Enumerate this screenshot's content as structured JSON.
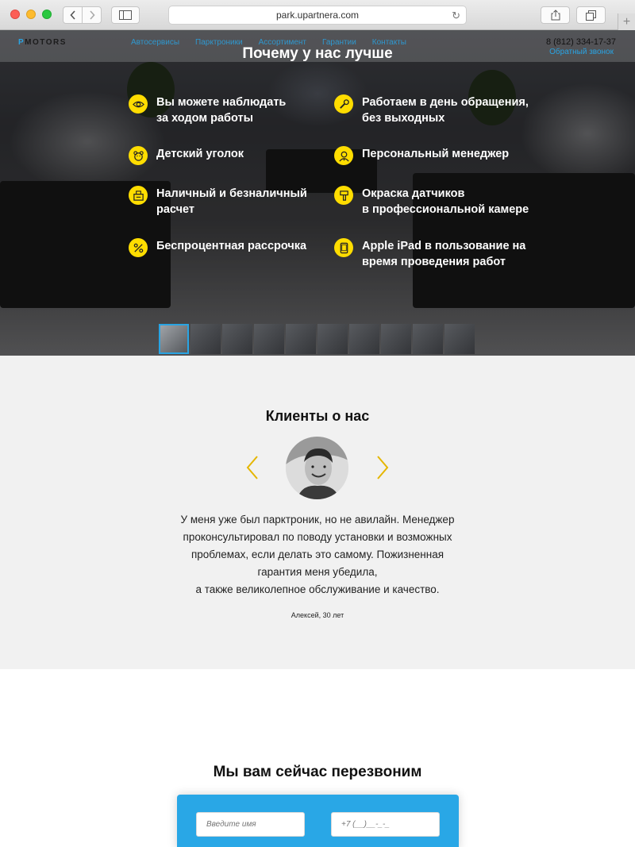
{
  "browser": {
    "url": "park.upartnera.com"
  },
  "site": {
    "logo_prefix": "P",
    "logo_text": "MOTORS",
    "nav": [
      "Автосервисы",
      "Парктроники",
      "Ассортимент",
      "Гарантии",
      "Контакты"
    ],
    "phone": "8 (812) 334-17-37",
    "callback_link": "Обратный звонок",
    "accent_color": "#29a4e3",
    "icon_color": "#ffdd00"
  },
  "hero": {
    "title": "Почему у нас лучше",
    "features": [
      {
        "icon": "eye-icon",
        "line1": "Вы можете наблюдать",
        "line2": "за ходом работы"
      },
      {
        "icon": "wrench-icon",
        "line1": "Работаем в день обращения,",
        "line2": "без выходных"
      },
      {
        "icon": "teddy-bear-icon",
        "line1": "Детский уголок",
        "line2": ""
      },
      {
        "icon": "manager-icon",
        "line1": "Персональный менеджер",
        "line2": ""
      },
      {
        "icon": "cash-register-icon",
        "line1": "Наличный и безналичный",
        "line2": "расчет"
      },
      {
        "icon": "spray-gun-icon",
        "line1": "Окраска датчиков",
        "line2": "в профессиональной камере"
      },
      {
        "icon": "percent-icon",
        "line1": "Беспроцентная рассрочка",
        "line2": ""
      },
      {
        "icon": "tablet-icon",
        "line1": "Apple iPad в пользование на",
        "line2": "время проведения работ"
      }
    ]
  },
  "reviews": {
    "title": "Клиенты о нас",
    "text_lines": [
      "У меня уже был парктроник, но не авилайн. Менеджер",
      "проконсультировал по поводу установки и возможных",
      "проблемах, если делать это самому. Пожизненная",
      "гарантия меня убедила,",
      "а также великолепное обслуживание и качество."
    ],
    "author": "Алексей, 30 лет"
  },
  "callback": {
    "title": "Мы вам сейчас перезвоним",
    "name_placeholder": "Введите имя",
    "phone_placeholder": "+7 (__)__-_-_"
  }
}
